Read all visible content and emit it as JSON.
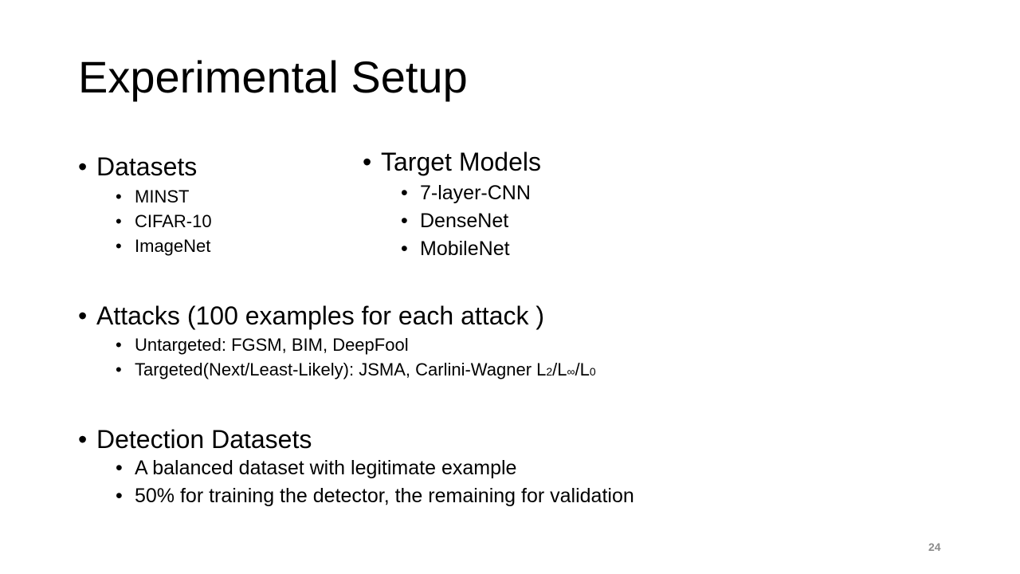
{
  "slide": {
    "title": "Experimental Setup",
    "bullet": "•",
    "page_number": "24"
  },
  "datasets": {
    "heading": "Datasets",
    "items": [
      "MINST",
      "CIFAR-10",
      "ImageNet"
    ]
  },
  "target_models": {
    "heading": "Target Models",
    "items": [
      "7-layer-CNN",
      "DenseNet",
      "MobileNet"
    ]
  },
  "attacks": {
    "heading": "Attacks (100 examples for each attack )",
    "untargeted": "Untargeted: FGSM, BIM, DeepFool",
    "targeted": {
      "prefix": "Targeted(Next/Least-Likely): JSMA, Carlini-Wagner L",
      "sub_2": "2",
      "sep_1": "/L",
      "sub_inf": "∞",
      "sep_2": "/L",
      "sub_0": "0"
    }
  },
  "detection": {
    "heading": "Detection Datasets",
    "items": [
      "A balanced dataset with legitimate example",
      "50% for training the detector, the remaining for validation"
    ]
  }
}
